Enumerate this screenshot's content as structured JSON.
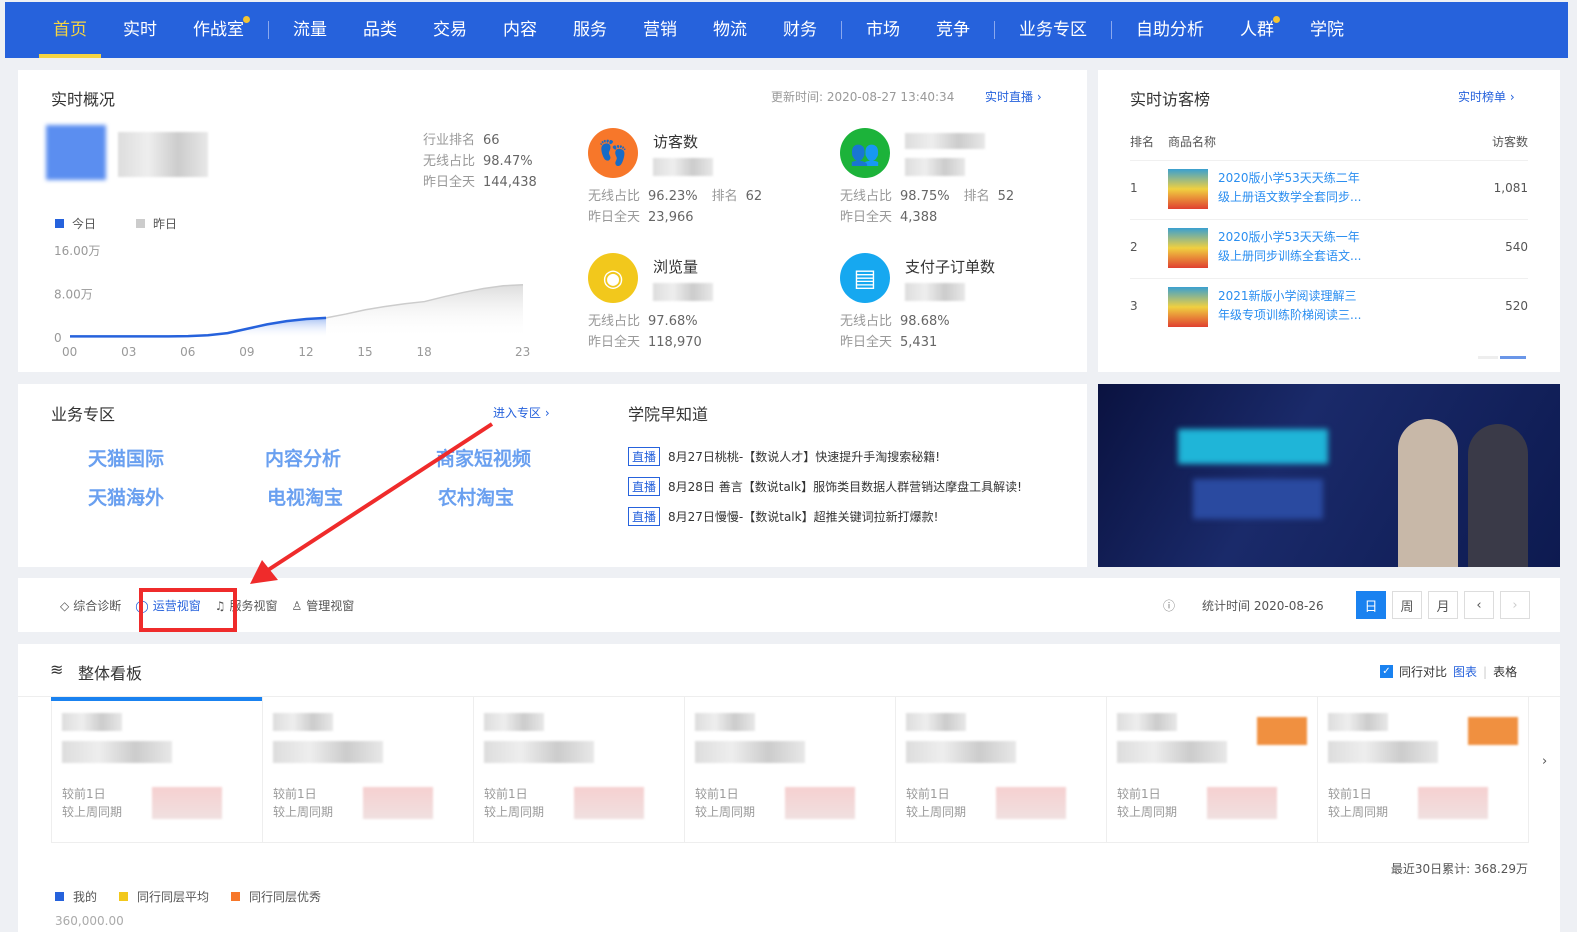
{
  "nav": {
    "items": [
      {
        "label": "首页",
        "active": true
      },
      {
        "label": "实时"
      },
      {
        "label": "作战室",
        "dot": true
      },
      {
        "sep": true
      },
      {
        "label": "流量"
      },
      {
        "label": "品类"
      },
      {
        "label": "交易"
      },
      {
        "label": "内容"
      },
      {
        "label": "服务"
      },
      {
        "label": "营销"
      },
      {
        "label": "物流"
      },
      {
        "label": "财务"
      },
      {
        "sep": true
      },
      {
        "label": "市场"
      },
      {
        "label": "竞争"
      },
      {
        "sep": true
      },
      {
        "label": "业务专区"
      },
      {
        "sep": true
      },
      {
        "label": "自助分析"
      },
      {
        "label": "人群",
        "dot": true
      },
      {
        "label": "学院"
      }
    ]
  },
  "overview": {
    "title": "实时概况",
    "update_label": "更新时间:",
    "update_time": "2020-08-27 13:40:34",
    "live_link": "实时直播",
    "stats": [
      {
        "label": "行业排名",
        "value": "66"
      },
      {
        "label": "无线占比",
        "value": "98.47%"
      },
      {
        "label": "昨日全天",
        "value": "144,438"
      }
    ],
    "legend": {
      "today": "今日",
      "yesterday": "昨日"
    },
    "kpis": [
      {
        "name": "访客数",
        "icon": "footprint-icon",
        "color": "#f7772a",
        "wireless_label": "无线占比",
        "wireless": "96.23%",
        "rank_label": "排名",
        "rank": "62",
        "yday_label": "昨日全天",
        "yday": "23,966"
      },
      {
        "name": "",
        "icon": "users-icon",
        "color": "#1cb33a",
        "wireless_label": "无线占比",
        "wireless": "98.75%",
        "rank_label": "排名",
        "rank": "52",
        "yday_label": "昨日全天",
        "yday": "4,388"
      },
      {
        "name": "浏览量",
        "icon": "eye-icon",
        "color": "#f2c81c",
        "wireless_label": "无线占比",
        "wireless": "97.68%",
        "yday_label": "昨日全天",
        "yday": "118,970"
      },
      {
        "name": "支付子订单数",
        "icon": "clipboard-icon",
        "color": "#16a8f0",
        "wireless_label": "无线占比",
        "wireless": "98.68%",
        "yday_label": "昨日全天",
        "yday": "5,431"
      }
    ]
  },
  "chart_data": {
    "type": "area",
    "x": [
      "00",
      "03",
      "06",
      "09",
      "12",
      "15",
      "18",
      "23"
    ],
    "yticks": [
      "0",
      "8.00万",
      "16.00万"
    ],
    "ylim": [
      0,
      160000
    ],
    "series": [
      {
        "name": "今日",
        "color": "#2662dc",
        "hours": [
          0,
          1,
          2,
          3,
          4,
          5,
          6,
          7,
          8,
          9,
          10,
          11,
          12,
          13
        ],
        "values": [
          3000,
          3000,
          3000,
          3000,
          3000,
          3000,
          3500,
          5000,
          9000,
          17000,
          25000,
          31000,
          35000,
          37000
        ]
      },
      {
        "name": "昨日",
        "color": "#cccccc",
        "hours": [
          13,
          14,
          15,
          16,
          17,
          18,
          19,
          20,
          21,
          22,
          23
        ],
        "values": [
          37000,
          44000,
          52000,
          58000,
          63000,
          67000,
          76000,
          84000,
          91000,
          96000,
          98000
        ]
      }
    ]
  },
  "rank": {
    "title": "实时访客榜",
    "link": "实时榜单",
    "headers": [
      "排名",
      "商品名称",
      "访客数"
    ],
    "rows": [
      {
        "rank": "1",
        "name1": "2020版小学53天天练二年",
        "name2": "级上册语文数学全套同步...",
        "visitors": "1,081"
      },
      {
        "rank": "2",
        "name1": "2020版小学53天天练一年",
        "name2": "级上册同步训练全套语文...",
        "visitors": "540"
      },
      {
        "rank": "3",
        "name1": "2021新版小学阅读理解三",
        "name2": "年级专项训练阶梯阅读三...",
        "visitors": "520"
      }
    ]
  },
  "biz": {
    "title": "业务专区",
    "link": "进入专区",
    "items": [
      "天猫国际",
      "内容分析",
      "商家短视频",
      "天猫海外",
      "电视淘宝",
      "农村淘宝"
    ]
  },
  "academy": {
    "title": "学院早知道",
    "items": [
      {
        "tag": "直播",
        "text": "8月27日桃桃-【数说人才】快速提升手淘搜索秘籍!"
      },
      {
        "tag": "直播",
        "text": "8月28日 善言【数说talk】服饰类目数据人群营销达摩盘工具解读!"
      },
      {
        "tag": "直播",
        "text": "8月27日慢慢-【数说talk】超推关键词拉新打爆款!"
      }
    ]
  },
  "toolbar": {
    "tabs": [
      "综合诊断",
      "运营视窗",
      "服务视窗",
      "管理视窗"
    ],
    "stat_label": "统计时间",
    "stat_date": "2020-08-26",
    "periods": [
      "日",
      "周",
      "月"
    ]
  },
  "board": {
    "title": "整体看板",
    "compare": "同行对比",
    "chart": "图表",
    "table": "表格",
    "cmp1": "较前1日",
    "cmp2": "较上周同期",
    "total": "最近30日累计: 368.29万",
    "legend": [
      {
        "label": "我的",
        "color": "#2662dc"
      },
      {
        "label": "同行同层平均",
        "color": "#f2c81c"
      },
      {
        "label": "同行同层优秀",
        "color": "#f7772a"
      }
    ],
    "ytick": "360,000.00"
  }
}
